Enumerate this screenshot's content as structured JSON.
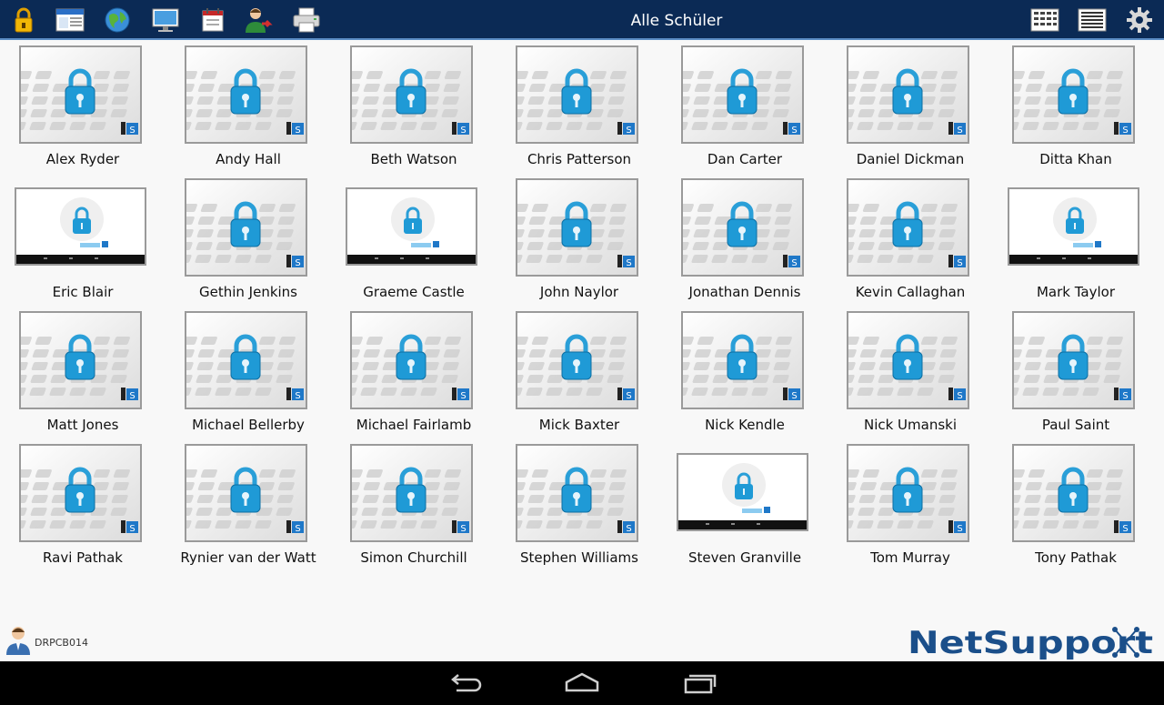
{
  "toolbar": {
    "title": "Alle Schüler",
    "left_icons": [
      "lock-icon",
      "window-icon",
      "globe-icon",
      "monitor-icon",
      "calendar-icon",
      "user-transfer-icon",
      "printer-icon"
    ],
    "right_icons": [
      "grid-view-icon",
      "list-view-icon",
      "gear-icon"
    ]
  },
  "students": [
    {
      "name": "Alex Ryder",
      "thumb": "lock"
    },
    {
      "name": "Andy Hall",
      "thumb": "lock"
    },
    {
      "name": "Beth Watson",
      "thumb": "lock"
    },
    {
      "name": "Chris Patterson",
      "thumb": "lock"
    },
    {
      "name": "Dan Carter",
      "thumb": "lock"
    },
    {
      "name": "Daniel Dickman",
      "thumb": "lock"
    },
    {
      "name": "Ditta Khan",
      "thumb": "lock"
    },
    {
      "name": "Eric Blair",
      "thumb": "wide"
    },
    {
      "name": "Gethin Jenkins",
      "thumb": "lock"
    },
    {
      "name": "Graeme Castle",
      "thumb": "wide"
    },
    {
      "name": "John Naylor",
      "thumb": "lock"
    },
    {
      "name": "Jonathan Dennis",
      "thumb": "lock"
    },
    {
      "name": "Kevin Callaghan",
      "thumb": "lock"
    },
    {
      "name": "Mark Taylor",
      "thumb": "wide"
    },
    {
      "name": "Matt Jones",
      "thumb": "lock"
    },
    {
      "name": "Michael Bellerby",
      "thumb": "lock"
    },
    {
      "name": "Michael Fairlamb",
      "thumb": "lock"
    },
    {
      "name": "Mick Baxter",
      "thumb": "lock"
    },
    {
      "name": "Nick Kendle",
      "thumb": "lock"
    },
    {
      "name": "Nick Umanski",
      "thumb": "lock"
    },
    {
      "name": "Paul Saint",
      "thumb": "lock"
    },
    {
      "name": "Ravi Pathak",
      "thumb": "lock"
    },
    {
      "name": "Rynier van der Watt",
      "thumb": "lock"
    },
    {
      "name": "Simon Churchill",
      "thumb": "lock"
    },
    {
      "name": "Stephen Williams",
      "thumb": "lock"
    },
    {
      "name": "Steven Granville",
      "thumb": "wide"
    },
    {
      "name": "Tom Murray",
      "thumb": "lock"
    },
    {
      "name": "Tony Pathak",
      "thumb": "lock"
    }
  ],
  "status": {
    "user_name": "DRPCB014",
    "logo_text": "NetSupport"
  },
  "nav": [
    "back-icon",
    "home-icon",
    "recent-apps-icon"
  ],
  "colors": {
    "toolbar_bg": "#0b2a55",
    "lock_blue": "#1f9ad6",
    "logo_blue": "#1b4f8a"
  }
}
